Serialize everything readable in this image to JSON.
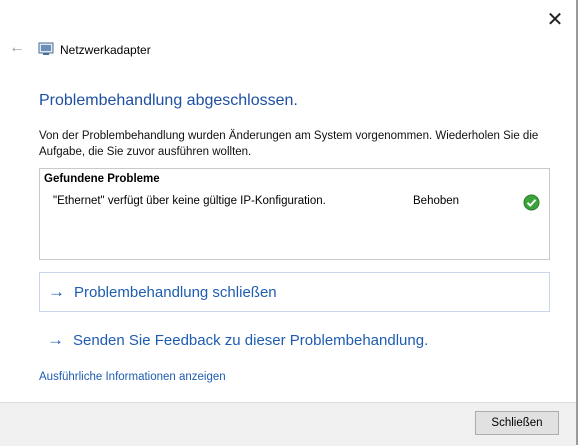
{
  "window": {
    "title": "Netzwerkadapter",
    "close_glyph": "✕",
    "back_glyph": "←"
  },
  "main": {
    "heading": "Problembehandlung abgeschlossen.",
    "description": "Von der Problembehandlung wurden Änderungen am System vorgenommen. Wiederholen Sie die Aufgabe, die Sie zuvor ausführen wollten."
  },
  "problems": {
    "header": "Gefundene Probleme",
    "items": [
      {
        "text": "\"Ethernet\" verfügt über keine gültige IP-Konfiguration.",
        "status": "Behoben",
        "status_icon": "green-check-icon"
      }
    ]
  },
  "actions": [
    {
      "label": "Problembehandlung schließen",
      "icon": "arrow-right-icon"
    },
    {
      "label": "Senden Sie Feedback zu dieser Problembehandlung.",
      "icon": "arrow-right-icon"
    }
  ],
  "details_link": "Ausführliche Informationen anzeigen",
  "footer": {
    "close_button": "Schließen"
  },
  "colors": {
    "accent": "#1e5cb3",
    "heading": "#1e4fa3",
    "success": "#3aa33a"
  }
}
